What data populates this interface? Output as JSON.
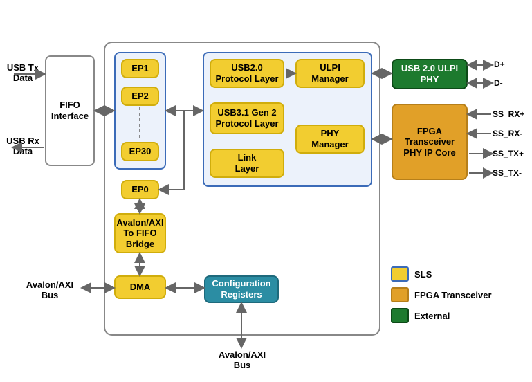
{
  "io": {
    "usb_tx": "USB Tx\nData",
    "usb_rx": "USB Rx\nData",
    "fifo_if": "FIFO\nInterface",
    "avalon_axi_bus_left": "Avalon/AXI\nBus",
    "avalon_axi_bus_bottom": "Avalon/AXI\nBus",
    "dplus": "D+",
    "dminus": "D-",
    "ssrxp": "SS_RX+",
    "ssrxm": "SS_RX-",
    "sstxp": "SS_TX+",
    "sstxm": "SS_TX-"
  },
  "eps": {
    "ep1": "EP1",
    "ep2": "EP2",
    "ep30": "EP30",
    "ep0": "EP0"
  },
  "blocks": {
    "usb20_protocol": "USB2.0\nProtocol Layer",
    "usb31_protocol": "USB3.1 Gen 2\nProtocol Layer",
    "link_layer": "Link\nLayer",
    "ulpi_manager": "ULPI\nManager",
    "phy_manager": "PHY\nManager",
    "bridge": "Avalon/AXI\nTo FIFO\nBridge",
    "dma": "DMA",
    "config_reg": "Configuration\nRegisters",
    "ulpi_phy": "USB 2.0 ULPI\nPHY",
    "fpga_phy": "FPGA\nTransceiver\nPHY IP Core"
  },
  "legend": {
    "sls": "SLS",
    "fpga": "FPGA Transceiver",
    "ext": "External"
  }
}
